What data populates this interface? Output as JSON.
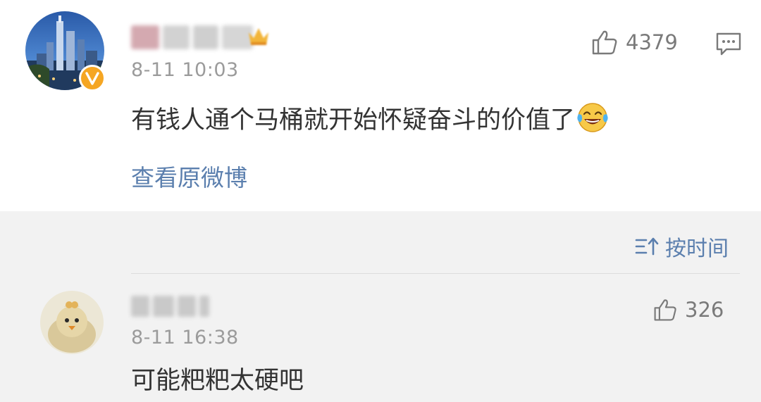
{
  "post": {
    "avatar_icon": "city-skyline-avatar",
    "verified_icon": "verified-v-badge-icon",
    "username_icon": "blurred-username",
    "member_icon": "crown-member-icon",
    "timestamp": "8-11 10:03",
    "content": "有钱人通个马桶就开始怀疑奋斗的价值了",
    "emoji_icon": "laughing-crying-emoji-icon",
    "like_icon": "thumbs-up-icon",
    "like_count": "4379",
    "comment_icon": "comment-bubble-icon",
    "view_original_label": "查看原微博"
  },
  "sort": {
    "icon": "sort-by-time-icon",
    "label": "按时间"
  },
  "replies": [
    {
      "avatar_icon": "duck-cookie-avatar",
      "username_icon": "blurred-username",
      "timestamp": "8-11 16:38",
      "content": "可能粑粑太硬吧",
      "like_icon": "thumbs-up-icon",
      "like_count": "326"
    }
  ],
  "colors": {
    "link": "#5b7fae",
    "text": "#333333",
    "muted": "#9b9b9b",
    "badge": "#f5a623",
    "panel_bg": "#f2f2f2"
  }
}
